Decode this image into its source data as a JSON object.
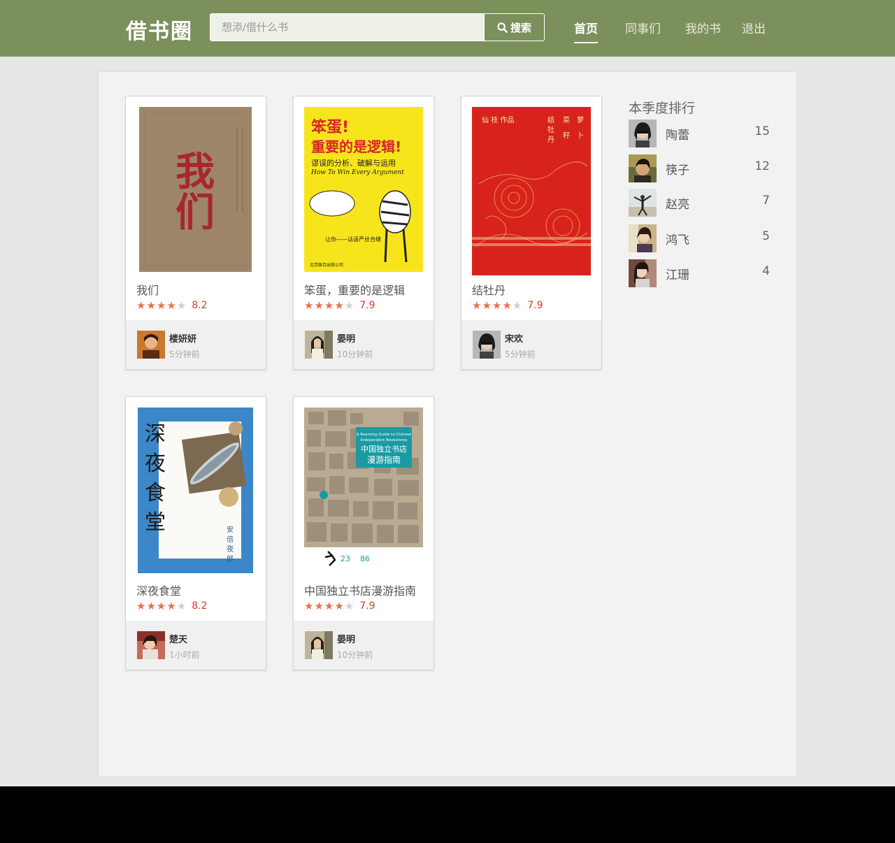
{
  "header": {
    "logo": "借书圈",
    "search_placeholder": "想添/借什么书",
    "search_button": "搜索",
    "nav": [
      {
        "label": "首页",
        "active": true
      },
      {
        "label": "同事们",
        "active": false
      },
      {
        "label": "我的书",
        "active": false
      },
      {
        "label": "退出",
        "active": false
      }
    ]
  },
  "books": [
    {
      "title": "我们",
      "rating_stars": 4,
      "score": "8.2",
      "user": "楼妍妍",
      "time": "5分钟前",
      "cover_bg": "#9c8565",
      "cover_text": "我们",
      "cover_text_color": "#a8272b"
    },
    {
      "title": "笨蛋，重要的是逻辑",
      "rating_stars": 4,
      "score": "7.9",
      "user": "晏明",
      "time": "10分钟前",
      "cover_bg": "#f5e61a",
      "cover_text": "笨蛋！重要的是逻辑！",
      "cover_text_color": "#d8242a"
    },
    {
      "title": "结牡丹",
      "rating_stars": 4,
      "score": "7.9",
      "user": "宋欢",
      "time": "5分钟前",
      "cover_bg": "#d8231d",
      "cover_text": "结牡丹",
      "cover_text_color": "#f4e1b3"
    },
    {
      "title": "深夜食堂",
      "rating_stars": 4,
      "score": "8.2",
      "user": "楚天",
      "time": "1小时前",
      "cover_bg": "#3b87c7",
      "cover_text": "深夜食堂",
      "cover_text_color": "#1a1a1a"
    },
    {
      "title": "中国独立书店漫游指南",
      "rating_stars": 4,
      "score": "7.9",
      "user": "晏明",
      "time": "10分钟前",
      "cover_bg": "#c9c1b0",
      "cover_text": "中国独立书店漫游指南",
      "cover_text_color": "#ffffff"
    }
  ],
  "ranking": {
    "title": "本季度排行",
    "items": [
      {
        "name": "陶蕾",
        "count": "15"
      },
      {
        "name": "筷子",
        "count": "12"
      },
      {
        "name": "赵亮",
        "count": "7"
      },
      {
        "name": "鸿飞",
        "count": "5"
      },
      {
        "name": "江珊",
        "count": "4"
      }
    ]
  },
  "colors": {
    "header_green": "#7c905c",
    "star_on": "#e9704a",
    "score_red": "#d63c23"
  }
}
